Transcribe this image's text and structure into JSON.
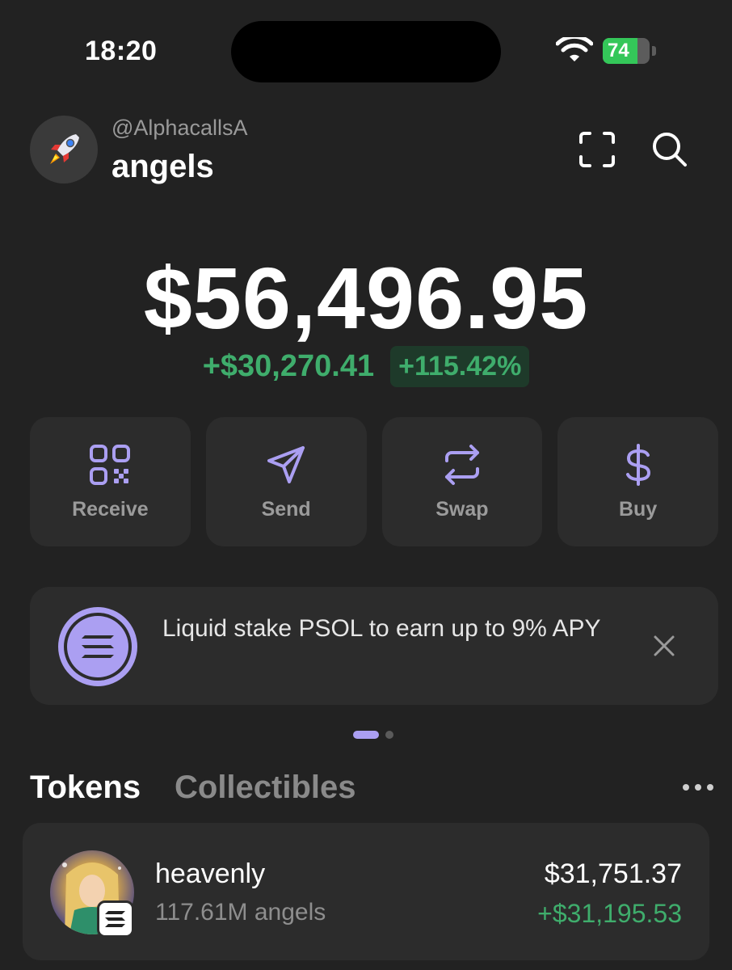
{
  "status_bar": {
    "time": "18:20",
    "battery": "74",
    "battery_level": 0.74,
    "icons": [
      "wifi-icon",
      "battery-charging-icon"
    ]
  },
  "header": {
    "handle": "@AlphacallsA",
    "account_name": "angels",
    "avatar_icon": "rocket-icon",
    "right_icons": [
      "scan-icon",
      "search-icon"
    ]
  },
  "balance": {
    "total": "$56,496.95",
    "change_amount": "+$30,270.41",
    "change_percent": "+115.42%"
  },
  "actions": [
    {
      "label": "Receive",
      "icon": "qr-code-icon"
    },
    {
      "label": "Send",
      "icon": "send-icon"
    },
    {
      "label": "Swap",
      "icon": "swap-icon"
    },
    {
      "label": "Buy",
      "icon": "dollar-icon"
    }
  ],
  "promo": {
    "text": "Liquid stake PSOL to earn up to 9% APY",
    "icon": "solana-icon",
    "close_icon": "close-icon"
  },
  "carousel": {
    "pages": 2,
    "active": 1
  },
  "tabs": [
    {
      "label": "Tokens",
      "active": true
    },
    {
      "label": "Collectibles",
      "active": false
    }
  ],
  "tokens": [
    {
      "name": "heavenly",
      "amount": "117.61M angels",
      "value": "$31,751.37",
      "change": "+$31,195.53",
      "chain_icon": "solana-icon"
    }
  ],
  "colors": {
    "background": "#222222",
    "card": "#2c2c2c",
    "accent": "#ab9ff2",
    "positive": "#3fad6c"
  }
}
